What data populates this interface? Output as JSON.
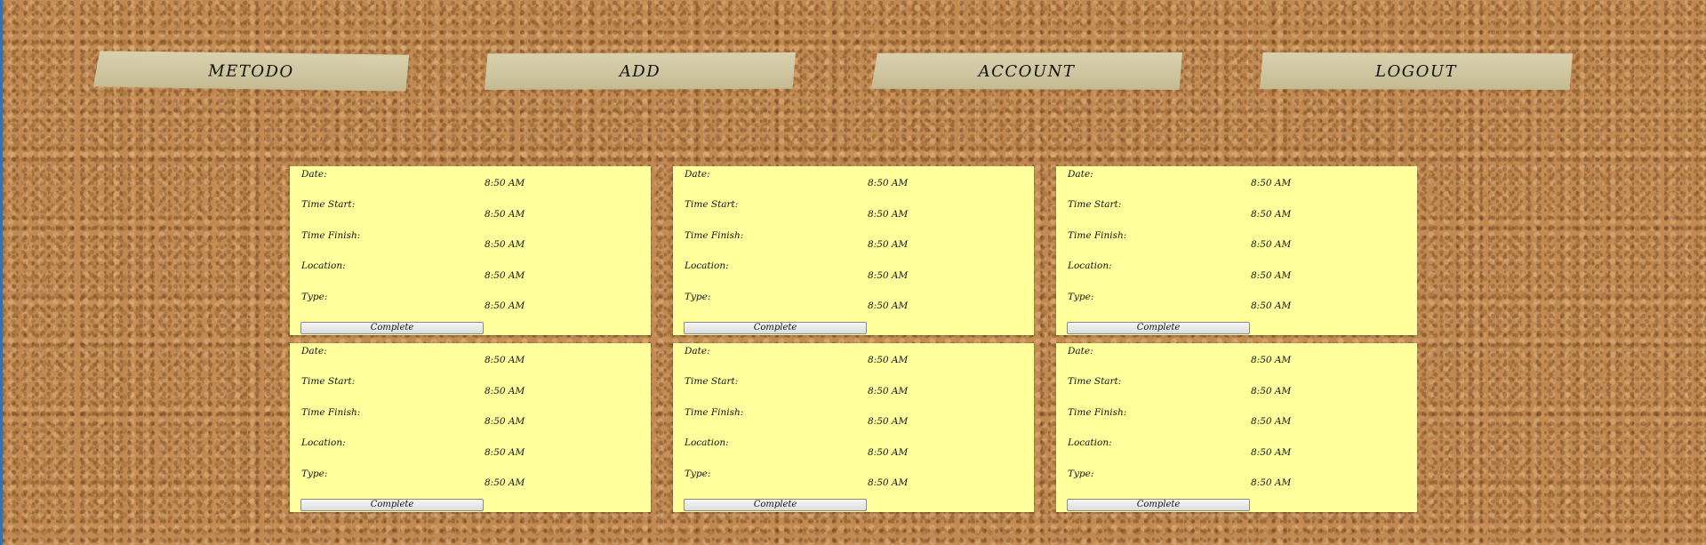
{
  "nav": {
    "metodo": "METODO",
    "add": "ADD",
    "account": "ACCOUNT",
    "logout": "LOGOUT"
  },
  "labels": {
    "date": "Date:",
    "time_start": "Time Start:",
    "time_finish": "Time Finish:",
    "location": "Location:",
    "type": "Type:",
    "complete_button": "Complete"
  },
  "notes": [
    {
      "date": "8:50 AM",
      "time_start": "8:50 AM",
      "time_finish": "8:50 AM",
      "location": "8:50 AM",
      "type": "8:50 AM"
    },
    {
      "date": "8:50 AM",
      "time_start": "8:50 AM",
      "time_finish": "8:50 AM",
      "location": "8:50 AM",
      "type": "8:50 AM"
    },
    {
      "date": "8:50 AM",
      "time_start": "8:50 AM",
      "time_finish": "8:50 AM",
      "location": "8:50 AM",
      "type": "8:50 AM"
    },
    {
      "date": "8:50 AM",
      "time_start": "8:50 AM",
      "time_finish": "8:50 AM",
      "location": "8:50 AM",
      "type": "8:50 AM"
    },
    {
      "date": "8:50 AM",
      "time_start": "8:50 AM",
      "time_finish": "8:50 AM",
      "location": "8:50 AM",
      "type": "8:50 AM"
    },
    {
      "date": "8:50 AM",
      "time_start": "8:50 AM",
      "time_finish": "8:50 AM",
      "location": "8:50 AM",
      "type": "8:50 AM"
    }
  ],
  "colors": {
    "note_background": "#ffff9c",
    "tape": "#cfc6a0",
    "cork": "#c08a52"
  }
}
